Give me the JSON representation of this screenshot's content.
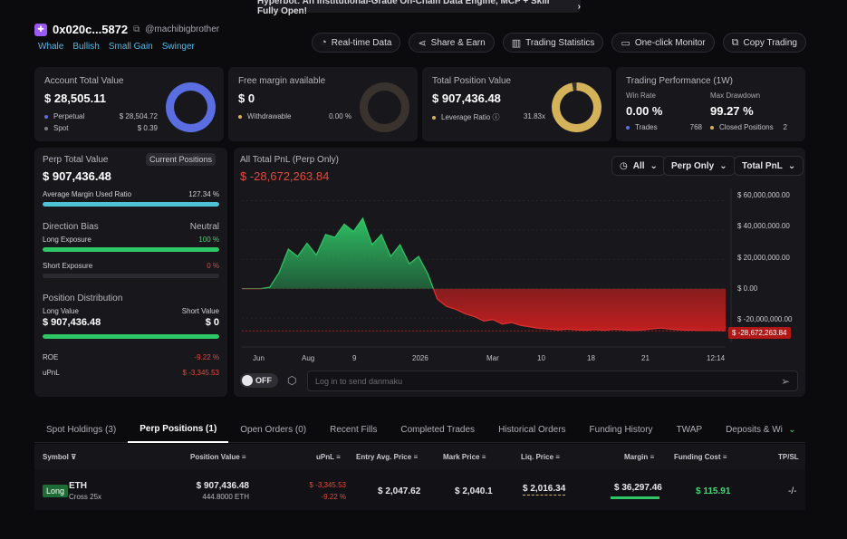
{
  "banner": {
    "text": "Hyperbot: An Institutional-Grade On-Chain Data Engine, MCP + Skill Fully Open!",
    "chevron": "›"
  },
  "header": {
    "address": "0x020c...5872",
    "handle": "@machibigbrother",
    "tags": [
      "Whale",
      "Bullish",
      "Small Gain",
      "Swinger"
    ],
    "buttons": [
      {
        "label": "Real-time Data",
        "icon": "realtime-icon"
      },
      {
        "label": "Share & Earn",
        "icon": "share-icon"
      },
      {
        "label": "Trading Statistics",
        "icon": "statistics-icon"
      },
      {
        "label": "One-click Monitor",
        "icon": "monitor-icon"
      },
      {
        "label": "Copy Trading",
        "icon": "copy-icon"
      }
    ]
  },
  "account": {
    "label": "Account Total Value",
    "value": "$ 28,505.11",
    "perp_label": "Perpetual",
    "perp_value": "$ 28,504.72",
    "spot_label": "Spot",
    "spot_value": "$ 0.39",
    "color": "#5b6ee1"
  },
  "margin": {
    "label": "Free margin available",
    "value": "$ 0",
    "withdrawable_label": "Withdrawable",
    "withdrawable_value": "0.00 %",
    "color": "#3a322c"
  },
  "position": {
    "label": "Total Position Value",
    "value": "$ 907,436.48",
    "leverage_label": "Leverage Ratio",
    "leverage_value": "31.83x",
    "color": "#d4b25a"
  },
  "performance": {
    "label": "Trading Performance (1W)",
    "win_rate_label": "Win Rate",
    "win_rate": "0.00 %",
    "drawdown_label": "Max Drawdown",
    "drawdown": "99.27 %",
    "trades_label": "Trades",
    "trades": "768",
    "closed_label": "Closed Positions",
    "closed": "2"
  },
  "left_panel": {
    "perp_total_label": "Perp Total Value",
    "current_positions": "Current Positions",
    "perp_total_value": "$ 907,436.48",
    "avg_margin_label": "Average Margin Used Ratio",
    "avg_margin_value": "127.34 %",
    "avg_margin_fill": 1.0,
    "direction_label": "Direction Bias",
    "direction_value": "Neutral",
    "long_exposure_label": "Long Exposure",
    "long_exposure_value": "100 %",
    "long_fill": 1.0,
    "short_exposure_label": "Short Exposure",
    "short_exposure_value": "0 %",
    "short_fill": 0,
    "distribution_label": "Position Distribution",
    "long_value_label": "Long Value",
    "long_value": "$ 907,436.48",
    "short_value_label": "Short Value",
    "short_value": "$ 0",
    "roe_label": "ROE",
    "roe_value": "-9.22 %",
    "upnl_label": "uPnL",
    "upnl_value": "$ -3,345.53"
  },
  "chart_panel": {
    "title": "All Total PnL (Perp Only)",
    "current_value": "$ -28,672,263.84",
    "filters": [
      "All",
      "Perp Only",
      "Total PnL"
    ],
    "toggle": "OFF",
    "danmaku_placeholder": "Log in to send danmaku"
  },
  "chart_data": {
    "type": "area",
    "title": "All Total PnL (Perp Only)",
    "y_ticks": [
      "$ 60,000,000.00",
      "$ 40,000,000.00",
      "$ 20,000,000.00",
      "$ 0.00",
      "$ -20,000,000.00"
    ],
    "x_ticks": [
      "Jun",
      "Aug",
      "9",
      "2026",
      "Mar",
      "10",
      "18",
      "21",
      "12:14"
    ],
    "ylim": [
      -30000000,
      62000000
    ],
    "current_label": "$ -28,672,263.84",
    "positive_color": "#2fc766",
    "negative_color": "#d42020",
    "values": [
      0,
      0,
      0,
      1000000,
      11000000,
      27000000,
      22000000,
      31000000,
      23000000,
      37000000,
      35000000,
      44000000,
      39000000,
      48000000,
      30000000,
      37000000,
      22000000,
      30000000,
      17000000,
      22000000,
      10000000,
      -7000000,
      -12000000,
      -14000000,
      -17000000,
      -19000000,
      -22000000,
      -21000000,
      -24000000,
      -23000000,
      -25000000,
      -26000000,
      -27000000,
      -27500000,
      -28000000,
      -27500000,
      -28000000,
      -28200000,
      -27800000,
      -28300000,
      -27600000,
      -28000000,
      -28400000,
      -28100000,
      -27400000,
      -26800000,
      -27500000,
      -28000000,
      -28200000,
      -28300000,
      -28400000,
      -28500000,
      -28672263.84
    ]
  },
  "tabs": [
    "Spot Holdings (3)",
    "Perp Positions (1)",
    "Open Orders (0)",
    "Recent Fills",
    "Completed Trades",
    "Historical Orders",
    "Funding History",
    "TWAP",
    "Deposits & Withdrav"
  ],
  "active_tab": "Perp Positions (1)",
  "table": {
    "headers": [
      "Symbol",
      "Position Value",
      "uPnL",
      "Entry Avg. Price",
      "Mark Price",
      "Liq. Price",
      "Margin",
      "Funding Cost",
      "TP/SL"
    ],
    "row": {
      "side": "Long",
      "symbol": "ETH",
      "margin_type": "Cross 25x",
      "position_value": "$ 907,436.48",
      "position_size": "444.8000 ETH",
      "upnl": "$ -3,345.53",
      "upnl_pct": "-9.22 %",
      "entry_price": "$ 2,047.62",
      "mark_price": "$ 2,040.1",
      "liq_price": "$ 2,016.34",
      "margin": "$ 36,297.46",
      "funding_cost": "$ 115.91",
      "tpsl": "-/-"
    }
  }
}
